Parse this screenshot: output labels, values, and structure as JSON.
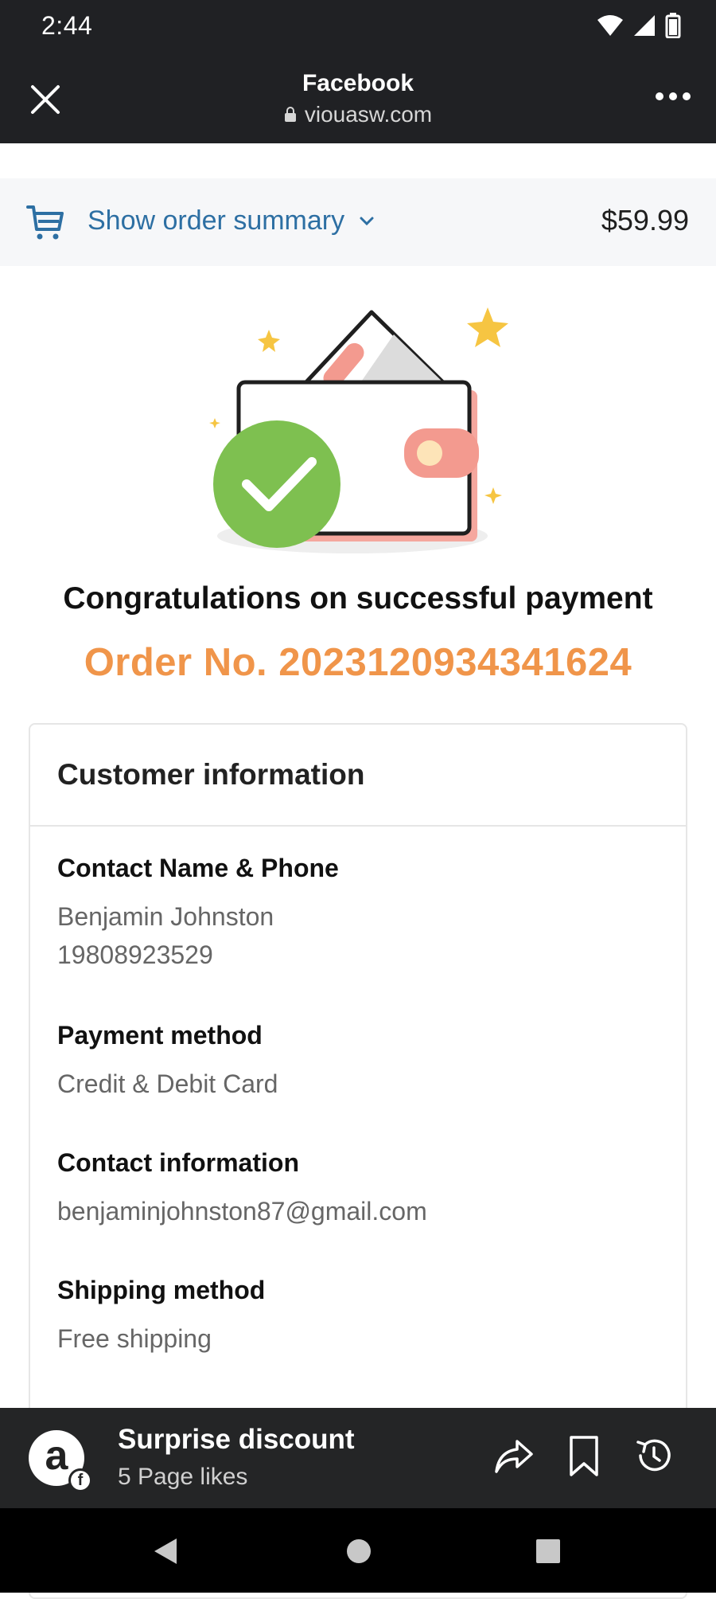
{
  "status_bar": {
    "time": "2:44"
  },
  "browser": {
    "title": "Facebook",
    "url": "viouasw.com"
  },
  "order_summary": {
    "label": "Show order summary",
    "price": "$59.99"
  },
  "confirmation": {
    "message": "Congratulations on successful payment",
    "order_number": "Order No. 2023120934341624"
  },
  "customer_info": {
    "heading": "Customer information",
    "fields": [
      {
        "label": "Contact Name & Phone",
        "values": [
          "Benjamin Johnston",
          "19808923529"
        ]
      },
      {
        "label": "Payment method",
        "values": [
          "Credit & Debit Card"
        ]
      },
      {
        "label": "Contact information",
        "values": [
          "benjaminjohnston87@gmail.com"
        ]
      },
      {
        "label": "Shipping method",
        "values": [
          "Free shipping"
        ]
      }
    ]
  },
  "facebook_bar": {
    "page_name": "Surprise discount",
    "page_likes": "5 Page likes",
    "avatar_letter": "a"
  },
  "colors": {
    "accent_orange": "#f0954a",
    "link_blue": "#2d6fa3",
    "success_green": "#7ec050",
    "dark_bar": "#202124"
  },
  "icons": [
    "close-icon",
    "lock-icon",
    "more-icon",
    "cart-icon",
    "chevron-down-icon",
    "share-icon",
    "bookmark-icon",
    "history-icon",
    "back-icon",
    "home-icon",
    "recents-icon"
  ]
}
